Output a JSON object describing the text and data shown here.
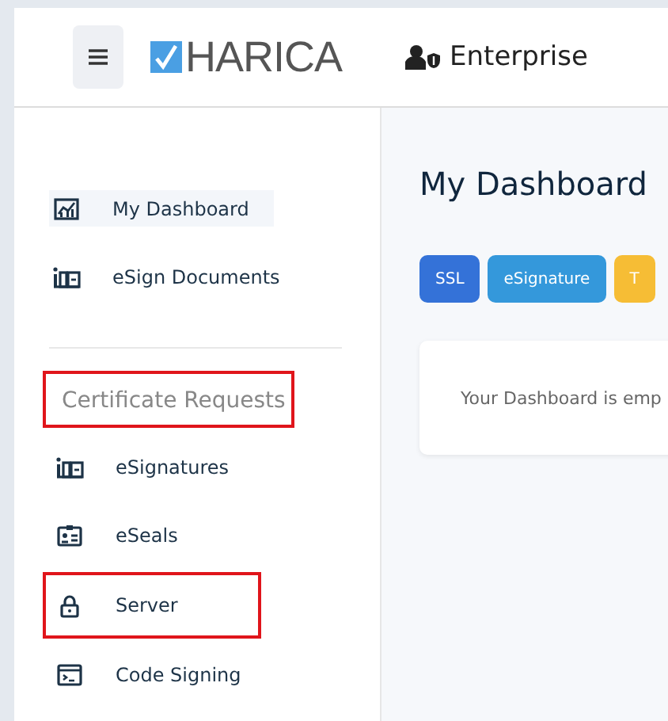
{
  "header": {
    "logo": "HARICA",
    "context": "Enterprise"
  },
  "sidebar": {
    "items": [
      {
        "label": "My Dashboard",
        "kind": "chart",
        "selected": true
      },
      {
        "label": "eSign Documents",
        "kind": "sign",
        "selected": false
      }
    ],
    "section": {
      "title": "Certificate Requests",
      "highlighted": true
    },
    "section_items": [
      {
        "label": "eSignatures",
        "kind": "sign",
        "selected": false,
        "highlighted": false
      },
      {
        "label": "eSeals",
        "kind": "card",
        "selected": false,
        "highlighted": false
      },
      {
        "label": "Server",
        "kind": "lock",
        "selected": false,
        "highlighted": true
      },
      {
        "label": "Code Signing",
        "kind": "terminal",
        "selected": false,
        "highlighted": false
      }
    ]
  },
  "main": {
    "title": "My Dashboard",
    "filters": [
      {
        "label": "SSL",
        "color": "#3472d8"
      },
      {
        "label": "eSignature",
        "color": "#3498db"
      },
      {
        "label": "T",
        "color": "#f6bd35"
      }
    ],
    "empty_message": "Your Dashboard is emp"
  }
}
